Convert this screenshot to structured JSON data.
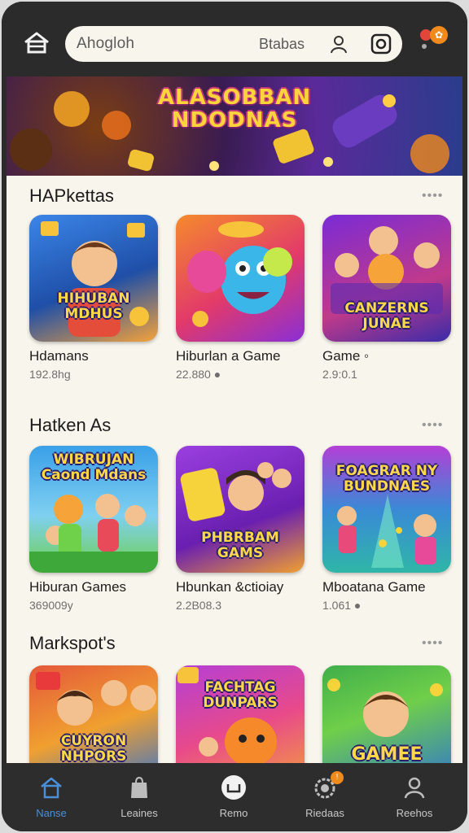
{
  "search": {
    "value": "Ahogloh",
    "hint": "Btabas"
  },
  "notification": {
    "badge_symbol": "✿"
  },
  "banner": {
    "title_line1": "ALASOBBAN",
    "title_line2": "NDODNAS"
  },
  "sections": [
    {
      "title": "HAPkettas",
      "more": "••••",
      "cards": [
        {
          "art_text": "HIHUBAN\nMDHUS",
          "title": "Hdamans",
          "subtitle": "192.8hg",
          "colors": [
            "#2c6fd6",
            "#f4a23a"
          ]
        },
        {
          "art_text": "",
          "title": "Hiburlan a Game",
          "subtitle": "22.880 ●",
          "colors": [
            "#f3722c",
            "#9b2fd6"
          ]
        },
        {
          "art_text": "CANZERNS\nJUNAE",
          "title": "Game ◦",
          "subtitle": "2.9:0.1",
          "colors": [
            "#7a2bd6",
            "#d63f6e"
          ]
        }
      ]
    },
    {
      "title": "Hatken As",
      "more": "••••",
      "cards": [
        {
          "art_text": "WIBRUJAN\nCaond Mdans",
          "title": "Hiburan Games",
          "subtitle": "369009y",
          "colors": [
            "#3aa0e8",
            "#6fcf4a"
          ]
        },
        {
          "art_text": "PHBRBAM\nGAMS",
          "title": "Hbunkan &ctioiay",
          "subtitle": "2.2B08.3",
          "colors": [
            "#8a2fd6",
            "#f0a030"
          ]
        },
        {
          "art_text": "FOAGRAR NY\nBUNDNAES",
          "title": "Mboatana Game",
          "subtitle": "1.061 ●",
          "colors": [
            "#2fb6a8",
            "#b43fd6"
          ]
        }
      ]
    },
    {
      "title": "Markspot's",
      "more": "••••",
      "cards": [
        {
          "art_text": "CUYRON\nNHPORS",
          "title": "",
          "subtitle": "",
          "colors": [
            "#e4583a",
            "#2c6fd6"
          ]
        },
        {
          "art_text": "FACHTAG\nDUNPARS",
          "title": "",
          "subtitle": "",
          "colors": [
            "#b43fd6",
            "#f4a23a"
          ]
        },
        {
          "art_text": "GAMEE",
          "title": "",
          "subtitle": "",
          "colors": [
            "#3fae4a",
            "#2c6fd6"
          ]
        }
      ]
    }
  ],
  "nav": [
    {
      "label": "Nanse",
      "active": true
    },
    {
      "label": "Leaines",
      "active": false
    },
    {
      "label": "Remo",
      "active": false
    },
    {
      "label": "Riedaas",
      "active": false,
      "badge": "!"
    },
    {
      "label": "Reehos",
      "active": false
    }
  ]
}
